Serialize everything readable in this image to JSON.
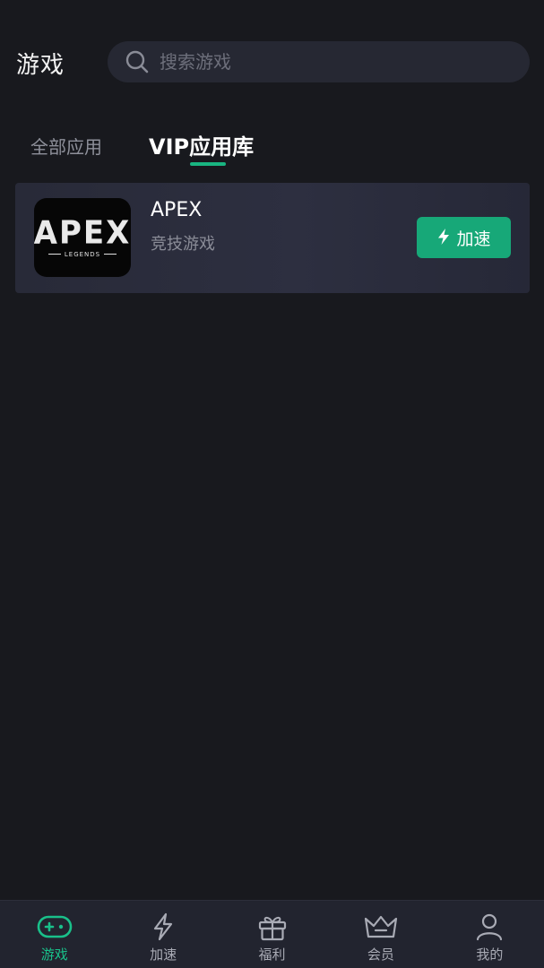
{
  "header": {
    "title": "游戏",
    "search_placeholder": "搜索游戏",
    "search_icon": "search-icon"
  },
  "tabs": [
    {
      "label": "全部应用",
      "active": false
    },
    {
      "label": "VIP应用库",
      "active": true
    }
  ],
  "colors": {
    "accent": "#19b581",
    "background": "#18191e",
    "card": "#2a2c3a",
    "nav_background": "#22242f"
  },
  "game_list": [
    {
      "name": "APEX",
      "category": "竞技游戏",
      "icon_logo": "APEX",
      "icon_logo_sub": "LEGENDS",
      "action_label": "加速",
      "action_icon": "lightning-icon"
    }
  ],
  "bottom_nav": [
    {
      "label": "游戏",
      "icon": "gamepad-icon",
      "active": true
    },
    {
      "label": "加速",
      "icon": "lightning-icon",
      "active": false
    },
    {
      "label": "福利",
      "icon": "gift-icon",
      "active": false
    },
    {
      "label": "会员",
      "icon": "crown-icon",
      "active": false
    },
    {
      "label": "我的",
      "icon": "user-icon",
      "active": false
    }
  ]
}
